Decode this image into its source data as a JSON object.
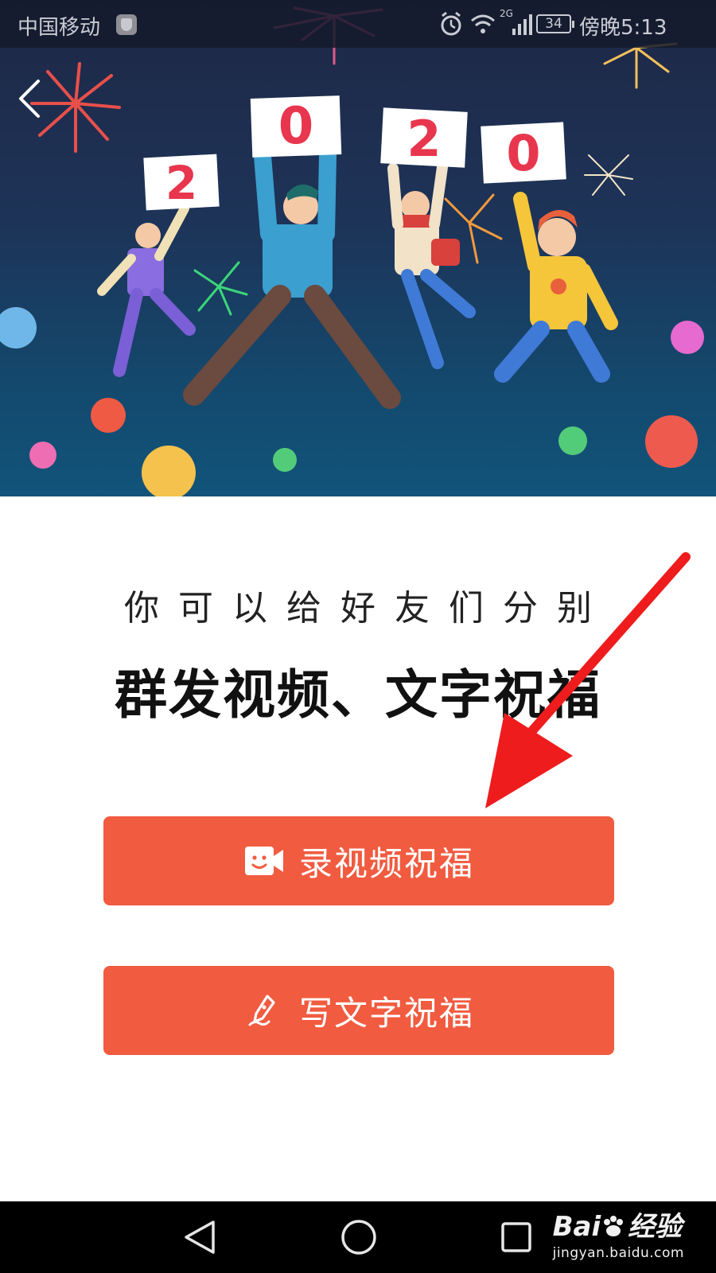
{
  "status_bar": {
    "carrier": "中国移动",
    "network": "2G",
    "battery": "34",
    "time": "傍晚5:13"
  },
  "banner": {
    "signs": [
      "2",
      "0",
      "2",
      "0"
    ],
    "description_icon": "new-year-celebration-illustration"
  },
  "content": {
    "subtitle": "你可以给好友们分别",
    "headline": "群发视频、文字祝福"
  },
  "buttons": {
    "video": {
      "label": "录视频祝福",
      "icon": "video-camera-icon"
    },
    "text": {
      "label": "写文字祝福",
      "icon": "pen-icon"
    }
  },
  "colors": {
    "button_bg": "#f15b40",
    "annotation_arrow": "#ee1c1c",
    "banner_top": "#1f2746",
    "banner_bottom": "#12547a"
  },
  "watermark": {
    "brand_latin": "Bai",
    "brand_cn": "经验",
    "url": "jingyan.baidu.com"
  }
}
